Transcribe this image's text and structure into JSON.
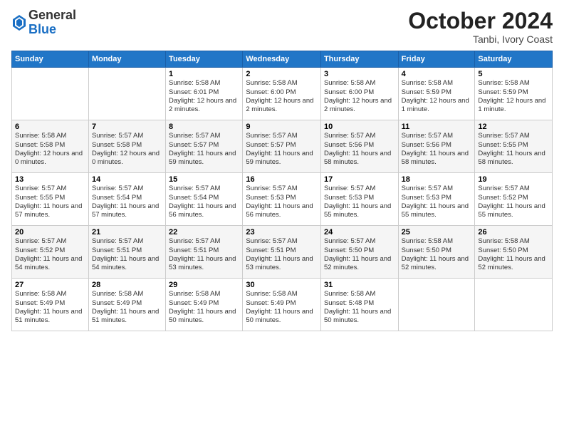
{
  "header": {
    "logo_general": "General",
    "logo_blue": "Blue",
    "month": "October 2024",
    "location": "Tanbi, Ivory Coast"
  },
  "weekdays": [
    "Sunday",
    "Monday",
    "Tuesday",
    "Wednesday",
    "Thursday",
    "Friday",
    "Saturday"
  ],
  "weeks": [
    [
      {
        "day": "",
        "info": ""
      },
      {
        "day": "",
        "info": ""
      },
      {
        "day": "1",
        "info": "Sunrise: 5:58 AM\nSunset: 6:01 PM\nDaylight: 12 hours\nand 2 minutes."
      },
      {
        "day": "2",
        "info": "Sunrise: 5:58 AM\nSunset: 6:00 PM\nDaylight: 12 hours\nand 2 minutes."
      },
      {
        "day": "3",
        "info": "Sunrise: 5:58 AM\nSunset: 6:00 PM\nDaylight: 12 hours\nand 2 minutes."
      },
      {
        "day": "4",
        "info": "Sunrise: 5:58 AM\nSunset: 5:59 PM\nDaylight: 12 hours\nand 1 minute."
      },
      {
        "day": "5",
        "info": "Sunrise: 5:58 AM\nSunset: 5:59 PM\nDaylight: 12 hours\nand 1 minute."
      }
    ],
    [
      {
        "day": "6",
        "info": "Sunrise: 5:58 AM\nSunset: 5:58 PM\nDaylight: 12 hours\nand 0 minutes."
      },
      {
        "day": "7",
        "info": "Sunrise: 5:57 AM\nSunset: 5:58 PM\nDaylight: 12 hours\nand 0 minutes."
      },
      {
        "day": "8",
        "info": "Sunrise: 5:57 AM\nSunset: 5:57 PM\nDaylight: 11 hours\nand 59 minutes."
      },
      {
        "day": "9",
        "info": "Sunrise: 5:57 AM\nSunset: 5:57 PM\nDaylight: 11 hours\nand 59 minutes."
      },
      {
        "day": "10",
        "info": "Sunrise: 5:57 AM\nSunset: 5:56 PM\nDaylight: 11 hours\nand 58 minutes."
      },
      {
        "day": "11",
        "info": "Sunrise: 5:57 AM\nSunset: 5:56 PM\nDaylight: 11 hours\nand 58 minutes."
      },
      {
        "day": "12",
        "info": "Sunrise: 5:57 AM\nSunset: 5:55 PM\nDaylight: 11 hours\nand 58 minutes."
      }
    ],
    [
      {
        "day": "13",
        "info": "Sunrise: 5:57 AM\nSunset: 5:55 PM\nDaylight: 11 hours\nand 57 minutes."
      },
      {
        "day": "14",
        "info": "Sunrise: 5:57 AM\nSunset: 5:54 PM\nDaylight: 11 hours\nand 57 minutes."
      },
      {
        "day": "15",
        "info": "Sunrise: 5:57 AM\nSunset: 5:54 PM\nDaylight: 11 hours\nand 56 minutes."
      },
      {
        "day": "16",
        "info": "Sunrise: 5:57 AM\nSunset: 5:53 PM\nDaylight: 11 hours\nand 56 minutes."
      },
      {
        "day": "17",
        "info": "Sunrise: 5:57 AM\nSunset: 5:53 PM\nDaylight: 11 hours\nand 55 minutes."
      },
      {
        "day": "18",
        "info": "Sunrise: 5:57 AM\nSunset: 5:53 PM\nDaylight: 11 hours\nand 55 minutes."
      },
      {
        "day": "19",
        "info": "Sunrise: 5:57 AM\nSunset: 5:52 PM\nDaylight: 11 hours\nand 55 minutes."
      }
    ],
    [
      {
        "day": "20",
        "info": "Sunrise: 5:57 AM\nSunset: 5:52 PM\nDaylight: 11 hours\nand 54 minutes."
      },
      {
        "day": "21",
        "info": "Sunrise: 5:57 AM\nSunset: 5:51 PM\nDaylight: 11 hours\nand 54 minutes."
      },
      {
        "day": "22",
        "info": "Sunrise: 5:57 AM\nSunset: 5:51 PM\nDaylight: 11 hours\nand 53 minutes."
      },
      {
        "day": "23",
        "info": "Sunrise: 5:57 AM\nSunset: 5:51 PM\nDaylight: 11 hours\nand 53 minutes."
      },
      {
        "day": "24",
        "info": "Sunrise: 5:57 AM\nSunset: 5:50 PM\nDaylight: 11 hours\nand 52 minutes."
      },
      {
        "day": "25",
        "info": "Sunrise: 5:58 AM\nSunset: 5:50 PM\nDaylight: 11 hours\nand 52 minutes."
      },
      {
        "day": "26",
        "info": "Sunrise: 5:58 AM\nSunset: 5:50 PM\nDaylight: 11 hours\nand 52 minutes."
      }
    ],
    [
      {
        "day": "27",
        "info": "Sunrise: 5:58 AM\nSunset: 5:49 PM\nDaylight: 11 hours\nand 51 minutes."
      },
      {
        "day": "28",
        "info": "Sunrise: 5:58 AM\nSunset: 5:49 PM\nDaylight: 11 hours\nand 51 minutes."
      },
      {
        "day": "29",
        "info": "Sunrise: 5:58 AM\nSunset: 5:49 PM\nDaylight: 11 hours\nand 50 minutes."
      },
      {
        "day": "30",
        "info": "Sunrise: 5:58 AM\nSunset: 5:49 PM\nDaylight: 11 hours\nand 50 minutes."
      },
      {
        "day": "31",
        "info": "Sunrise: 5:58 AM\nSunset: 5:48 PM\nDaylight: 11 hours\nand 50 minutes."
      },
      {
        "day": "",
        "info": ""
      },
      {
        "day": "",
        "info": ""
      }
    ]
  ]
}
